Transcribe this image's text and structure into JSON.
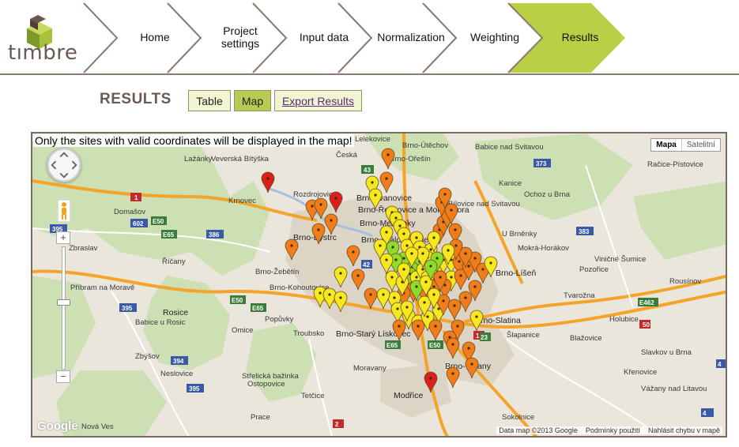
{
  "app": {
    "logo_text": "tımbre"
  },
  "steps": [
    {
      "label": "Home",
      "active": false
    },
    {
      "label": "Project\nsettings",
      "active": false
    },
    {
      "label": "Input data",
      "active": false
    },
    {
      "label": "Normalization",
      "active": false
    },
    {
      "label": "Weighting",
      "active": false
    },
    {
      "label": "Results",
      "active": true
    }
  ],
  "results": {
    "title": "RESULTS",
    "tab_table": "Table",
    "tab_map": "Map",
    "export_label": "Export Results"
  },
  "map": {
    "notice": "Only the sites with valid coordinates will be displayed in the map!",
    "type_map": "Mapa",
    "type_satellite": "Satelitní",
    "zoom_in": "+",
    "zoom_out": "−",
    "google": "Google",
    "attribution_data": "Data map ©2013 Google",
    "attribution_terms": "Podmínky použití",
    "attribution_report": "Nahlásit chybu v mapě",
    "places": [
      "Lelekovice",
      "Brno-Útěchov",
      "Babice nad Svitavou",
      "Lažánky",
      "Veverská Bítýška",
      "Česká",
      "Brno-Ořešín",
      "Račice-Pístovice",
      "Kanice",
      "Ochoz u Brna",
      "Rozdrojovice",
      "Brno-Ivanovice",
      "Brno-Řečkovice a Mokrá Hora",
      "Bílovice nad Svitavou",
      "Krnovec",
      "Domašov",
      "Brno-Medlánky",
      "U Brněnky",
      "Mokrá-Horákov",
      "Zbraslav",
      "Brno-Žebětín",
      "Brno-Bystrc",
      "Brno-Královo Pole",
      "Brno-Líšeň",
      "Viničné Šumice",
      "Pozořice",
      "Říčany",
      "Rousínov",
      "Příbram na Moravě",
      "Brno-Kohoutovice",
      "Tvarožna",
      "Rosice",
      "Popůvky",
      "Brno-Slatina",
      "Holubice",
      "Babice u Rosic",
      "Omice",
      "Troubsko",
      "Brno-Starý Lískovec",
      "Šlapanice",
      "Blažovice",
      "Zbýšov",
      "Slavkov u Brna",
      "Neslovice",
      "Moravany",
      "Brno-Tuřany",
      "Křenovice",
      "Střelická bažinka",
      "Ostopovice",
      "Vážany nad Litavou",
      "Tetčice",
      "Modřice",
      "Sokolnice",
      "Prace",
      "Nová Ves"
    ],
    "highways": [
      "43",
      "373",
      "1",
      "602",
      "E50",
      "E65",
      "386",
      "383",
      "395",
      "E462",
      "394",
      "50",
      "23",
      "2"
    ],
    "markers": {
      "legend_colors": {
        "red": "#d9201a",
        "orange": "#f07d1a",
        "yellow": "#f5e81e",
        "green": "#8edc2a"
      },
      "counts": {
        "red": 3,
        "orange": 52,
        "yellow": 38,
        "green": 9
      }
    }
  }
}
